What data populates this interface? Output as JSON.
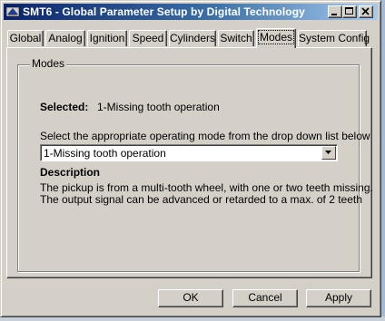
{
  "window": {
    "title": "SMT6 - Global Parameter Setup   by Digital Technology",
    "icon": "smt6-app-icon"
  },
  "tabs": [
    {
      "label": "Global",
      "active": false
    },
    {
      "label": "Analog",
      "active": false
    },
    {
      "label": "Ignition",
      "active": false
    },
    {
      "label": "Speed",
      "active": false
    },
    {
      "label": "Cylinders",
      "active": false
    },
    {
      "label": "Switch",
      "active": false
    },
    {
      "label": "Modes",
      "active": true
    },
    {
      "label": "System Config",
      "active": false
    }
  ],
  "modes": {
    "group_title": "Modes",
    "selected_label": "Selected:",
    "selected_value": "1-Missing tooth operation",
    "instruction": "Select the appropriate operating mode from the drop down list below",
    "dropdown_value": "1-Missing tooth operation",
    "description_heading": "Description",
    "description_lines": [
      "The pickup is from a multi-tooth wheel, with one or two teeth missing.",
      "The output signal can be advanced or retarded to a max. of 2 teeth"
    ]
  },
  "buttons": {
    "ok": "OK",
    "cancel": "Cancel",
    "apply": "Apply"
  },
  "colors": {
    "titlebar_start": "#0a246a",
    "titlebar_end": "#a6caf0",
    "face": "#d4d0c8"
  }
}
